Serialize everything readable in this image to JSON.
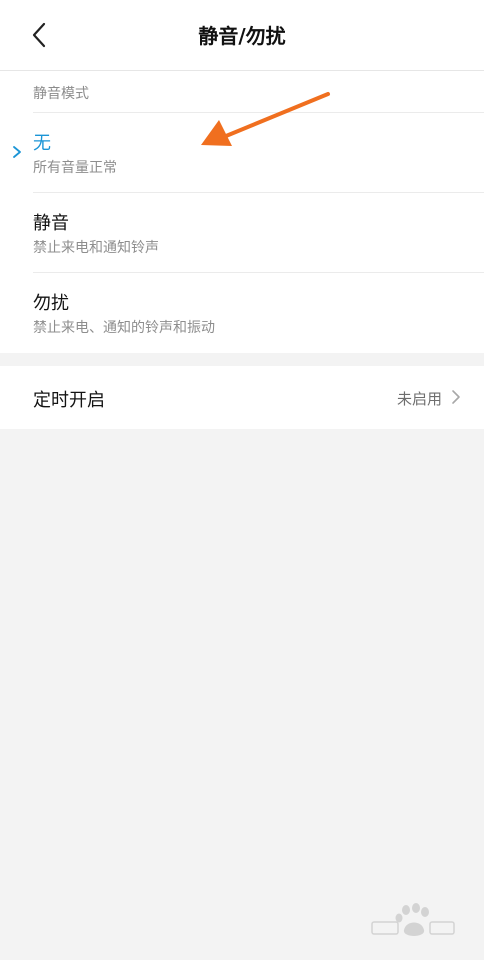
{
  "header": {
    "title": "静音/勿扰",
    "back_icon": "back-arrow-icon"
  },
  "modes": {
    "section_label": "静音模式",
    "items": [
      {
        "title": "无",
        "subtitle": "所有音量正常",
        "selected": true
      },
      {
        "title": "静音",
        "subtitle": "禁止来电和通知铃声",
        "selected": false
      },
      {
        "title": "勿扰",
        "subtitle": "禁止来电、通知的铃声和振动",
        "selected": false
      }
    ]
  },
  "timer": {
    "title": "定时开启",
    "status": "未启用",
    "chevron_icon": "chevron-right-icon"
  },
  "colors": {
    "accent": "#1b95d6",
    "annotation_arrow": "#f06f1f",
    "background": "#f3f3f3"
  },
  "watermark": {
    "brand": "Baidu",
    "icon": "baidu-paw-icon"
  }
}
